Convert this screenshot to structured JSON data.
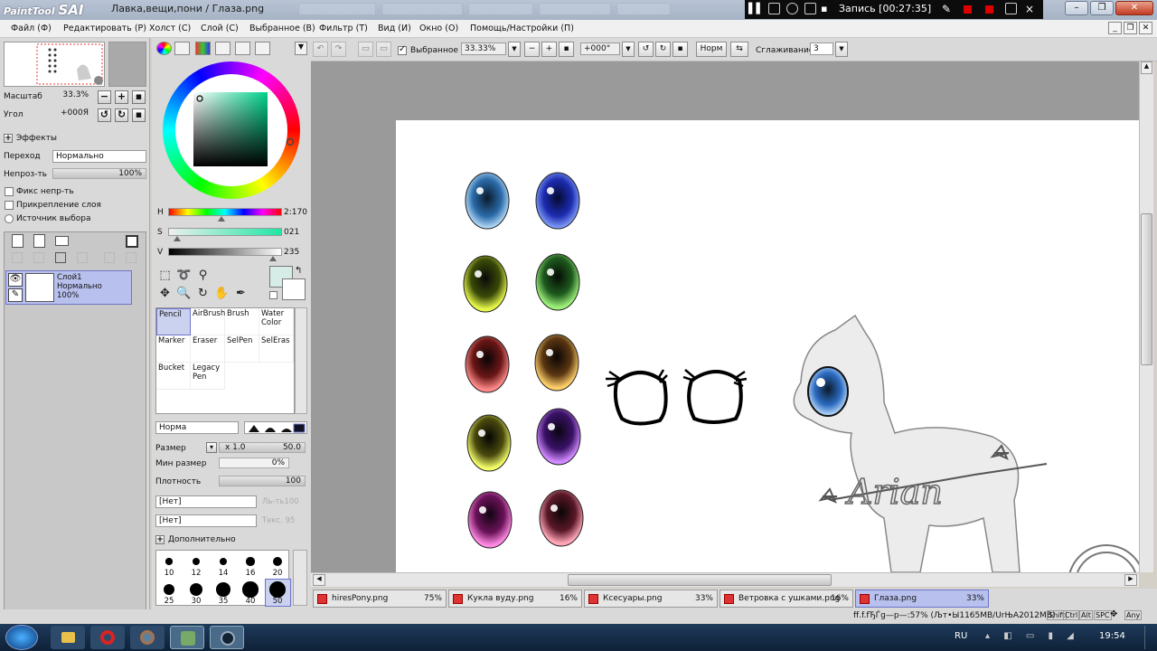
{
  "titlebar": {
    "app_logo_small": "PaintTool",
    "app_logo_big": "SAI",
    "window_title": "Лавка,вещи,пони / Глаза.png",
    "recording_label": "Запись [00:27:35]"
  },
  "menu": [
    "Файл (Ф)",
    "Редактировать (Р)",
    "Холст (С)",
    "Слой (С)",
    "Выбранное (В)",
    "Фильтр (Т)",
    "Вид (И)",
    "Окно (О)",
    "Помощь/Настройки (П)"
  ],
  "navigator": {
    "zoom_label": "Масштаб",
    "zoom_value": "33.3%",
    "angle_label": "Угол",
    "angle_value": "+000Я"
  },
  "layer_props": {
    "effects_label": "Эффекты",
    "blend_label": "Переход",
    "blend_value": "Нормально",
    "opacity_label": "Непроз-ть",
    "opacity_value": "100%",
    "fix_opacity_label": "Фикс непр-ть",
    "clip_label": "Прикрепление слоя",
    "selection_source_label": "Источник выбора"
  },
  "layer": {
    "name": "Слой1",
    "mode": "Нормально",
    "opacity": "100%"
  },
  "color": {
    "h_label": "H",
    "h_value": "2:170",
    "s_label": "S",
    "s_value": "021",
    "v_label": "V",
    "v_value": "235",
    "h_level": 0.47,
    "s_level": 0.08,
    "v_level": 0.92,
    "main_color": "#d6ece6"
  },
  "brushes": [
    {
      "name": "Pencil",
      "selected": true
    },
    {
      "name": "AirBrush"
    },
    {
      "name": "Brush"
    },
    {
      "name": "Water Color"
    },
    {
      "name": "Marker"
    },
    {
      "name": "Eraser"
    },
    {
      "name": "SelPen"
    },
    {
      "name": "SelEras"
    },
    {
      "name": "Bucket"
    },
    {
      "name": "Legacy Pen"
    }
  ],
  "brush_settings": {
    "mode": "Норма",
    "size_label": "Размер",
    "size_mult": "x 1.0",
    "size_value": "50.0",
    "min_size_label": "Мин размер",
    "min_size_value": "0%",
    "density_label": "Плотность",
    "density_value": "100",
    "texture1": "[Нет]",
    "texture1_side": "Ль-ть100",
    "texture2": "[Нет]",
    "texture2_side": "Текс.  95",
    "advanced_label": "Дополнительно",
    "dot_sizes": [
      "10",
      "12",
      "14",
      "16",
      "20",
      "25",
      "30",
      "35",
      "40",
      "50"
    ]
  },
  "toolbar": {
    "selection_label": "Выбранное",
    "zoom_value": "33.33%",
    "angle_value": "+000°",
    "norm_label": "Норм",
    "smoothing_label": "Сглаживание",
    "smoothing_value": "3"
  },
  "canvas": {
    "signature": "Arian"
  },
  "file_tabs": [
    {
      "name": "hiresPony.png",
      "zoom": "75%"
    },
    {
      "name": "Кукла вуду.png",
      "zoom": "16%"
    },
    {
      "name": "Ксесуары.png",
      "zoom": "33%"
    },
    {
      "name": "Ветровка с ушками.png",
      "zoom": "16%"
    },
    {
      "name": "Глаза.png",
      "zoom": "33%",
      "selected": true
    }
  ],
  "status": {
    "memory": "ff.f.fЂЃg—р—:57% (Љт•Ы1165MB/UrЊA2012MB)",
    "keys": [
      "Shift",
      "Ctrl",
      "Alt",
      "SPC",
      "Any"
    ]
  },
  "taskbar": {
    "lang": "RU",
    "time": "19:54"
  }
}
